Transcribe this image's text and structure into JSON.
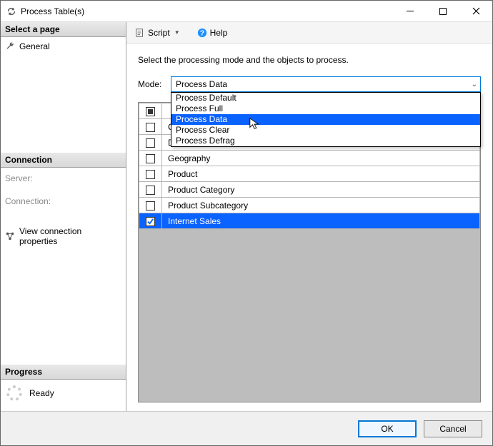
{
  "window": {
    "title": "Process Table(s)"
  },
  "sidebar": {
    "select_page_header": "Select a page",
    "pages": [
      {
        "label": "General"
      }
    ],
    "connection_header": "Connection",
    "server_label": "Server:",
    "connection_label": "Connection:",
    "view_conn_label": "View connection properties",
    "progress_header": "Progress",
    "progress_status": "Ready"
  },
  "toolbar": {
    "script_label": "Script",
    "help_label": "Help"
  },
  "main": {
    "instruction": "Select the processing mode and the objects to process.",
    "mode_label": "Mode:",
    "mode_selected": "Process Data",
    "mode_options": [
      "Process Default",
      "Process Full",
      "Process Data",
      "Process Clear",
      "Process Defrag"
    ],
    "tables": [
      {
        "name": "Customer",
        "checked": false
      },
      {
        "name": "Date",
        "checked": false
      },
      {
        "name": "Geography",
        "checked": false
      },
      {
        "name": "Product",
        "checked": false
      },
      {
        "name": "Product Category",
        "checked": false
      },
      {
        "name": "Product Subcategory",
        "checked": false
      },
      {
        "name": "Internet Sales",
        "checked": true,
        "selected": true
      }
    ]
  },
  "footer": {
    "ok": "OK",
    "cancel": "Cancel"
  }
}
